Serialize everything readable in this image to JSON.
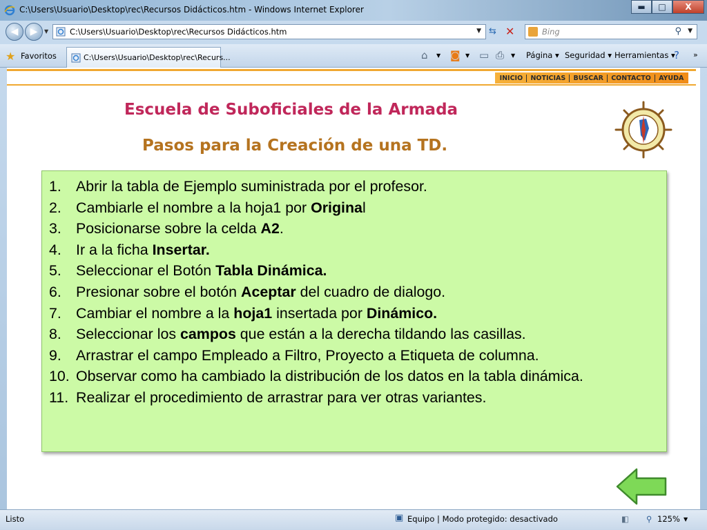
{
  "window": {
    "title": "C:\\Users\\Usuario\\Desktop\\rec\\Recursos Didácticos.htm - Windows Internet Explorer",
    "minimize": "▬",
    "maximize": "□",
    "close": "X"
  },
  "address": {
    "url": "C:\\Users\\Usuario\\Desktop\\rec\\Recursos Didácticos.htm",
    "search_placeholder": "Bing"
  },
  "favorites": {
    "label": "Favoritos",
    "tab_title": "C:\\Users\\Usuario\\Desktop\\rec\\Recurs..."
  },
  "commands": {
    "page": "Página",
    "security": "Seguridad",
    "tools": "Herramientas"
  },
  "site_nav": [
    "INICIO",
    "NOTICIAS",
    "BUSCAR",
    "CONTACTO",
    "AYUDA"
  ],
  "heading": "Escuela de Suboficiales de la Armada",
  "subheading": "Pasos para la Creación de una TD.",
  "steps": [
    {
      "num": "1.",
      "parts": [
        {
          "t": "Abrir la tabla de Ejemplo suministrada por el profesor."
        }
      ]
    },
    {
      "num": "2.",
      "parts": [
        {
          "t": "Cambiarle el nombre a la hoja1 por "
        },
        {
          "t": "Origina",
          "b": true
        },
        {
          "t": "l"
        }
      ]
    },
    {
      "num": "3.",
      "parts": [
        {
          "t": "Posicionarse sobre la celda "
        },
        {
          "t": "A2",
          "b": true
        },
        {
          "t": "."
        }
      ]
    },
    {
      "num": "4.",
      "parts": [
        {
          "t": "Ir a la ficha "
        },
        {
          "t": "Insertar.",
          "b": true
        }
      ]
    },
    {
      "num": "5.",
      "parts": [
        {
          "t": "Seleccionar  el Botón "
        },
        {
          "t": "Tabla Dinámica.",
          "b": true
        }
      ]
    },
    {
      "num": "6.",
      "parts": [
        {
          "t": "Presionar sobre el botón "
        },
        {
          "t": "Aceptar",
          "b": true
        },
        {
          "t": " del cuadro de dialogo."
        }
      ]
    },
    {
      "num": "7.",
      "parts": [
        {
          "t": "Cambiar el nombre a la "
        },
        {
          "t": "hoja1",
          "b": true
        },
        {
          "t": " insertada por "
        },
        {
          "t": "Dinámico.",
          "b": true
        }
      ]
    },
    {
      "num": "8.",
      "parts": [
        {
          "t": "Seleccionar los "
        },
        {
          "t": "campos",
          "b": true
        },
        {
          "t": " que están a la derecha tildando las casillas."
        }
      ]
    },
    {
      "num": "9.",
      "parts": [
        {
          "t": "Arrastrar el campo Empleado a Filtro, Proyecto a Etiqueta de columna."
        }
      ]
    },
    {
      "num": "10.",
      "parts": [
        {
          "t": "Observar como ha cambiado la distribución de los datos en la tabla dinámica."
        }
      ]
    },
    {
      "num": "11.",
      "parts": [
        {
          "t": "Realizar el procedimiento de arrastrar para ver otras variantes."
        }
      ]
    }
  ],
  "status": {
    "left": "Listo",
    "zone": "Equipo | Modo protegido: desactivado",
    "zoom": "125%"
  },
  "colors": {
    "heading": "#c0275a",
    "subheading": "#b5731f",
    "box_bg": "#ccfaa6",
    "arrow": "#7ed957"
  }
}
